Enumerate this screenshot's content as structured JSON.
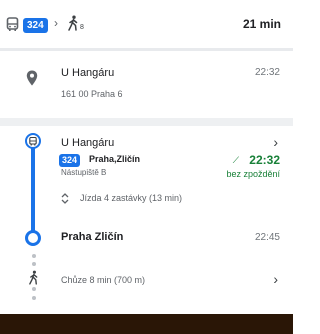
{
  "header": {
    "bus_line": "324",
    "walk_icon_sub": "8",
    "total_time": "21 min"
  },
  "origin": {
    "name": "U Hangáru",
    "address": "161 00 Praha 6",
    "time": "22:32"
  },
  "transit": {
    "stop_name": "U Hangáru",
    "line": "324",
    "destination": "Praha,Zličín",
    "platform": "Nástupiště B",
    "departure_time": "22:32",
    "status": "bez zpoždění",
    "ride_info": "Jízda 4 zastávky (13 min)",
    "arrival_stop": "Praha Zličín",
    "arrival_time": "22:45"
  },
  "walk": {
    "label": "Chůze 8 min (700 m)"
  },
  "colors": {
    "line_blue": "#1a73e8",
    "status_green": "#188038",
    "dark_bar": "#2a1606"
  }
}
